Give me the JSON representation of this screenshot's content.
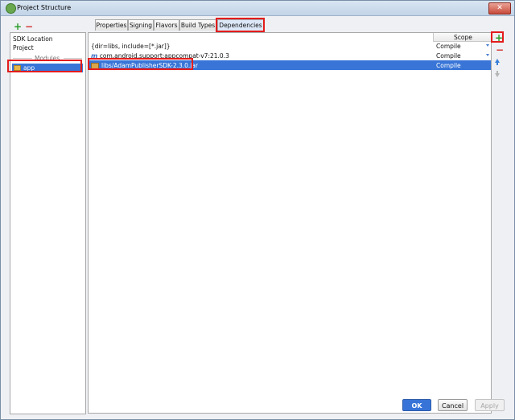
{
  "window": {
    "title": "Project Structure"
  },
  "left_toolbar": {
    "add": "+",
    "remove": "−"
  },
  "left_panel": {
    "items": [
      "SDK Location",
      "Project"
    ],
    "modules_header": "Modules",
    "modules": [
      {
        "label": "app",
        "selected": true
      }
    ]
  },
  "tabs": [
    "Properties",
    "Signing",
    "Flavors",
    "Build Types",
    "Dependencies"
  ],
  "active_tab": "Dependencies",
  "dependencies": {
    "header": {
      "scope": "Scope"
    },
    "rows": [
      {
        "icon": "",
        "label": "{dir=libs, include=[*.jar]}",
        "scope": "Compile",
        "selected": false
      },
      {
        "icon": "m",
        "label": "com.android.support:appcompat-v7:21.0.3",
        "scope": "Compile",
        "selected": false
      },
      {
        "icon": "jar",
        "label": "libs/AdamPublisherSDK-2.3.0.jar",
        "scope": "Compile",
        "selected": true
      }
    ]
  },
  "right_toolbar": {
    "add": "+",
    "remove": "−"
  },
  "buttons": {
    "ok": "OK",
    "cancel": "Cancel",
    "apply": "Apply"
  },
  "colors": {
    "selection": "#3875d7",
    "highlight_box": "#e41c1c",
    "add_green": "#2a9d2a",
    "remove_red": "#d32f2f"
  }
}
